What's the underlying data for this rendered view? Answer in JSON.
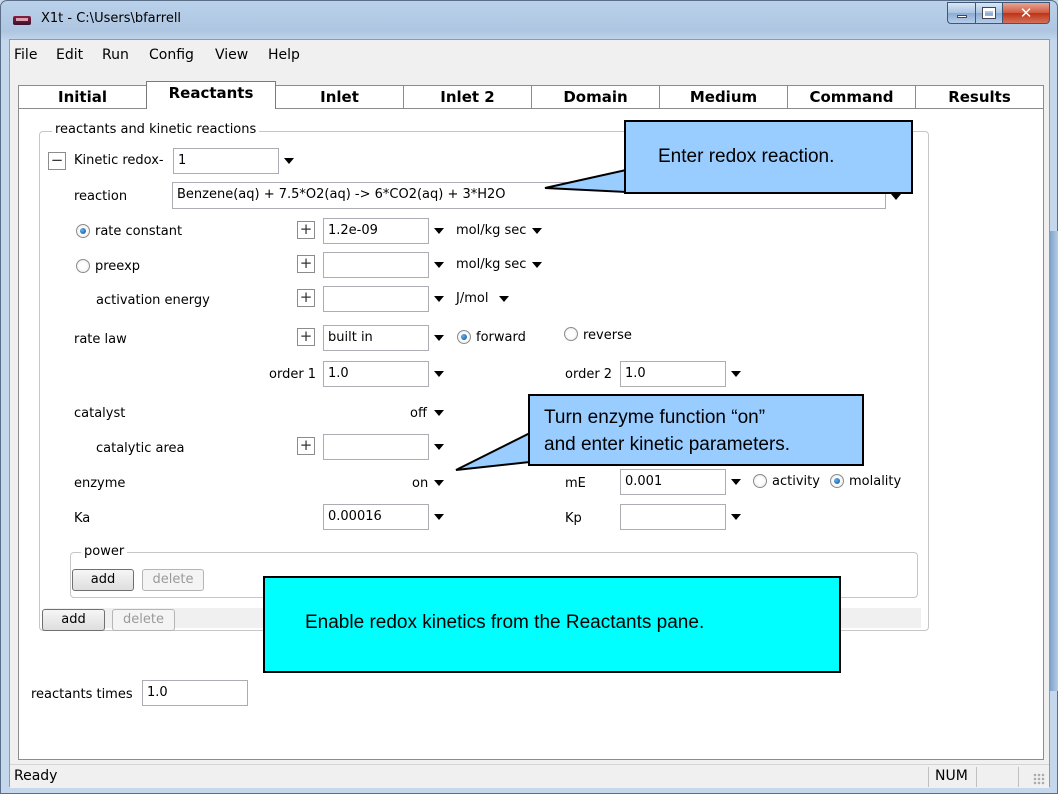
{
  "window": {
    "title": "X1t - C:\\Users\\bfarrell",
    "minimize": "",
    "maximize": "",
    "close": "✕"
  },
  "menu": [
    "File",
    "Edit",
    "Run",
    "Config",
    "View",
    "Help"
  ],
  "tabs": [
    "Initial",
    "Reactants",
    "Inlet",
    "Inlet 2",
    "Domain",
    "Medium",
    "Command",
    "Results"
  ],
  "active_tab": "Reactants",
  "group": {
    "label": "reactants and kinetic reactions",
    "kinetic_label": "Kinetic redox-",
    "kinetic_value": "1",
    "reaction_label": "reaction",
    "reaction_value": "Benzene(aq)  + 7.5*O2(aq)  -> 6*CO2(aq)  + 3*H2O",
    "rate_constant_label": "rate constant",
    "rate_constant_value": "1.2e-09",
    "rate_constant_unit": "mol/kg sec",
    "preexp_label": "preexp",
    "preexp_value": "",
    "preexp_unit": "mol/kg sec",
    "activation_label": "activation energy",
    "activation_value": "",
    "activation_unit": "J/mol",
    "rate_law_label": "rate law",
    "rate_law_value": "built in",
    "forward_label": "forward",
    "reverse_label": "reverse",
    "order1_label": "order 1",
    "order1_value": "1.0",
    "order2_label": "order 2",
    "order2_value": "1.0",
    "catalyst_label": "catalyst",
    "catalyst_value": "off",
    "catalytic_area_label": "catalytic area",
    "catalytic_area_value": "",
    "enzyme_label": "enzyme",
    "enzyme_value": "on",
    "mE_label": "mE",
    "mE_value": "0.001",
    "activity_label": "activity",
    "molality_label": "molality",
    "Ka_label": "Ka",
    "Ka_value": "0.00016",
    "Kp_label": "Kp",
    "Kp_value": "",
    "power_label": "power",
    "add_label": "add",
    "delete_label": "delete"
  },
  "reactants_times_label": "reactants times",
  "reactants_times_value": "1.0",
  "callouts": {
    "redox": "Enter redox reaction.",
    "enzyme_line1": "Turn enzyme function “on”",
    "enzyme_line2": "and enter kinetic parameters.",
    "kinetics": "Enable redox kinetics from the Reactants pane."
  },
  "status": {
    "text": "Ready",
    "num": "NUM"
  },
  "colors": {
    "callout_blue": "#99ccff",
    "callout_cyan": "#00ffff"
  }
}
